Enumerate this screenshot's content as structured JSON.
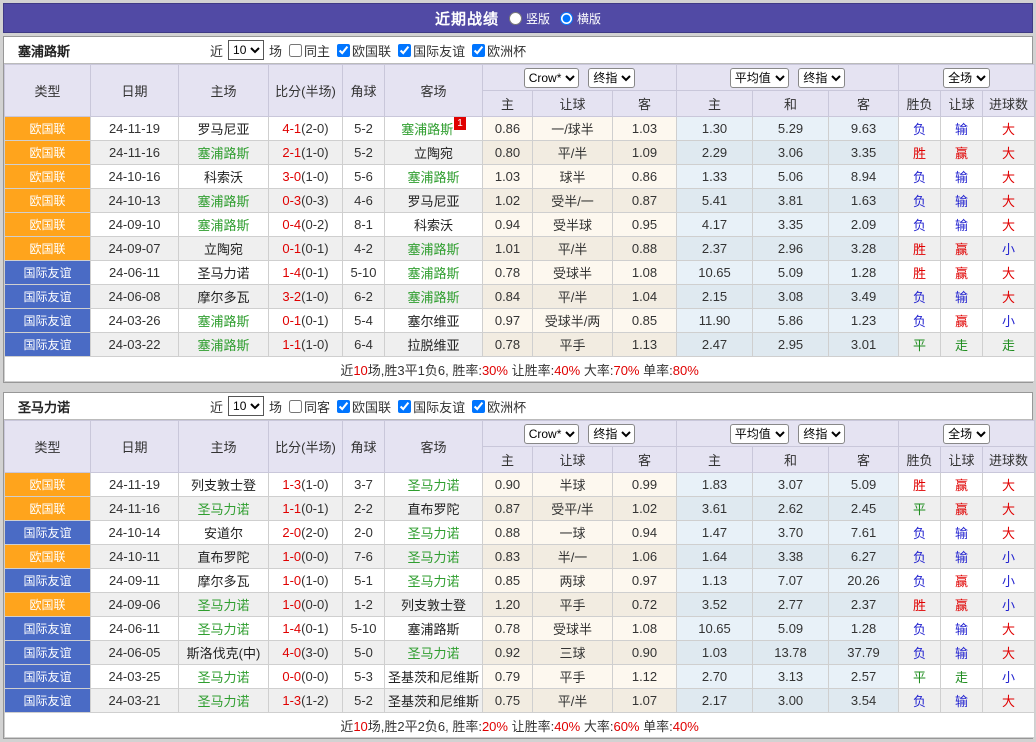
{
  "colors": {
    "header_bar": "#514aa5",
    "league_badge_euro_nations": "#ffa41c",
    "league_badge_friendly": "#4a6bc5",
    "team_highlight_green": "#2f9e2f",
    "win_red": "#e00000",
    "loss_blue": "#2424d0",
    "draw_green": "#1e8c1e",
    "header_row_bg": "#e5e3f2",
    "odds_col_bg": "#fdf8ef",
    "avg_col_bg": "#e8f1f8"
  },
  "title_bar": {
    "title": "近期战绩",
    "vertical_label": "竖版",
    "horizontal_label": "横版"
  },
  "filters": {
    "near_label": "近",
    "count": "10",
    "games_label": "场",
    "leagues": [
      "欧国联",
      "国际友谊",
      "欧洲杯"
    ]
  },
  "columns": {
    "type": "类型",
    "date": "日期",
    "home": "主场",
    "score": "比分(半场)",
    "corner": "角球",
    "away": "客场",
    "sub": [
      "主",
      "让球",
      "客",
      "主",
      "和",
      "客",
      "胜负",
      "让球",
      "进球数"
    ]
  },
  "group_selects": {
    "crow": "Crow*",
    "final": "终指",
    "avg": "平均值",
    "full": "全场"
  },
  "sections": [
    {
      "team": "塞浦路斯",
      "same_label": "同主",
      "rows": [
        {
          "league": "欧国联",
          "date": "24-11-19",
          "home": "罗马尼亚",
          "score": "4-1",
          "half": "(2-0)",
          "corner": "5-2",
          "away": "塞浦路斯",
          "badge": "1",
          "odds": [
            "0.86",
            "一/球半",
            "1.03"
          ],
          "avg": [
            "1.30",
            "5.29",
            "9.63"
          ],
          "results": [
            "负",
            "输",
            "大"
          ]
        },
        {
          "league": "欧国联",
          "date": "24-11-16",
          "home": "塞浦路斯",
          "score": "2-1",
          "half": "(1-0)",
          "corner": "5-2",
          "away": "立陶宛",
          "odds": [
            "0.80",
            "平/半",
            "1.09"
          ],
          "avg": [
            "2.29",
            "3.06",
            "3.35"
          ],
          "results": [
            "胜",
            "赢",
            "大"
          ]
        },
        {
          "league": "欧国联",
          "date": "24-10-16",
          "home": "科索沃",
          "score": "3-0",
          "half": "(1-0)",
          "corner": "5-6",
          "away": "塞浦路斯",
          "odds": [
            "1.03",
            "球半",
            "0.86"
          ],
          "avg": [
            "1.33",
            "5.06",
            "8.94"
          ],
          "results": [
            "负",
            "输",
            "大"
          ]
        },
        {
          "league": "欧国联",
          "date": "24-10-13",
          "home": "塞浦路斯",
          "score": "0-3",
          "half": "(0-3)",
          "corner": "4-6",
          "away": "罗马尼亚",
          "odds": [
            "1.02",
            "受半/一",
            "0.87"
          ],
          "avg": [
            "5.41",
            "3.81",
            "1.63"
          ],
          "results": [
            "负",
            "输",
            "大"
          ]
        },
        {
          "league": "欧国联",
          "date": "24-09-10",
          "home": "塞浦路斯",
          "score": "0-4",
          "half": "(0-2)",
          "corner": "8-1",
          "away": "科索沃",
          "odds": [
            "0.94",
            "受半球",
            "0.95"
          ],
          "avg": [
            "4.17",
            "3.35",
            "2.09"
          ],
          "results": [
            "负",
            "输",
            "大"
          ]
        },
        {
          "league": "欧国联",
          "date": "24-09-07",
          "home": "立陶宛",
          "score": "0-1",
          "half": "(0-1)",
          "corner": "4-2",
          "away": "塞浦路斯",
          "odds": [
            "1.01",
            "平/半",
            "0.88"
          ],
          "avg": [
            "2.37",
            "2.96",
            "3.28"
          ],
          "results": [
            "胜",
            "赢",
            "小"
          ]
        },
        {
          "league": "国际友谊",
          "date": "24-06-11",
          "home": "圣马力诺",
          "score": "1-4",
          "half": "(0-1)",
          "corner": "5-10",
          "away": "塞浦路斯",
          "odds": [
            "0.78",
            "受球半",
            "1.08"
          ],
          "avg": [
            "10.65",
            "5.09",
            "1.28"
          ],
          "results": [
            "胜",
            "赢",
            "大"
          ]
        },
        {
          "league": "国际友谊",
          "date": "24-06-08",
          "home": "摩尔多瓦",
          "score": "3-2",
          "half": "(1-0)",
          "corner": "6-2",
          "away": "塞浦路斯",
          "odds": [
            "0.84",
            "平/半",
            "1.04"
          ],
          "avg": [
            "2.15",
            "3.08",
            "3.49"
          ],
          "results": [
            "负",
            "输",
            "大"
          ]
        },
        {
          "league": "国际友谊",
          "date": "24-03-26",
          "home": "塞浦路斯",
          "score": "0-1",
          "half": "(0-1)",
          "corner": "5-4",
          "away": "塞尔维亚",
          "odds": [
            "0.97",
            "受球半/两",
            "0.85"
          ],
          "avg": [
            "11.90",
            "5.86",
            "1.23"
          ],
          "results": [
            "负",
            "赢",
            "小"
          ]
        },
        {
          "league": "国际友谊",
          "date": "24-03-22",
          "home": "塞浦路斯",
          "score": "1-1",
          "half": "(1-0)",
          "corner": "6-4",
          "away": "拉脱维亚",
          "odds": [
            "0.78",
            "平手",
            "1.13"
          ],
          "avg": [
            "2.47",
            "2.95",
            "3.01"
          ],
          "results": [
            "平",
            "走",
            "走"
          ]
        }
      ],
      "summary": [
        [
          "近",
          "d"
        ],
        [
          "10",
          "r"
        ],
        [
          "场,胜3平1负6, 胜率:",
          "d"
        ],
        [
          "30%",
          "r"
        ],
        [
          " 让胜率:",
          "d"
        ],
        [
          "40%",
          "r"
        ],
        [
          " 大率:",
          "d"
        ],
        [
          "70%",
          "r"
        ],
        [
          " 单率:",
          "d"
        ],
        [
          "80%",
          "r"
        ]
      ]
    },
    {
      "team": "圣马力诺",
      "same_label": "同客",
      "rows": [
        {
          "league": "欧国联",
          "date": "24-11-19",
          "home": "列支敦士登",
          "score": "1-3",
          "half": "(1-0)",
          "corner": "3-7",
          "away": "圣马力诺",
          "odds": [
            "0.90",
            "半球",
            "0.99"
          ],
          "avg": [
            "1.83",
            "3.07",
            "5.09"
          ],
          "results": [
            "胜",
            "赢",
            "大"
          ]
        },
        {
          "league": "欧国联",
          "date": "24-11-16",
          "home": "圣马力诺",
          "score": "1-1",
          "half": "(0-1)",
          "corner": "2-2",
          "away": "直布罗陀",
          "odds": [
            "0.87",
            "受平/半",
            "1.02"
          ],
          "avg": [
            "3.61",
            "2.62",
            "2.45"
          ],
          "results": [
            "平",
            "赢",
            "大"
          ]
        },
        {
          "league": "国际友谊",
          "date": "24-10-14",
          "home": "安道尔",
          "score": "2-0",
          "half": "(2-0)",
          "corner": "2-0",
          "away": "圣马力诺",
          "odds": [
            "0.88",
            "一球",
            "0.94"
          ],
          "avg": [
            "1.47",
            "3.70",
            "7.61"
          ],
          "results": [
            "负",
            "输",
            "大"
          ]
        },
        {
          "league": "欧国联",
          "date": "24-10-11",
          "home": "直布罗陀",
          "score": "1-0",
          "half": "(0-0)",
          "corner": "7-6",
          "away": "圣马力诺",
          "odds": [
            "0.83",
            "半/一",
            "1.06"
          ],
          "avg": [
            "1.64",
            "3.38",
            "6.27"
          ],
          "results": [
            "负",
            "输",
            "小"
          ]
        },
        {
          "league": "国际友谊",
          "date": "24-09-11",
          "home": "摩尔多瓦",
          "score": "1-0",
          "half": "(1-0)",
          "corner": "5-1",
          "away": "圣马力诺",
          "odds": [
            "0.85",
            "两球",
            "0.97"
          ],
          "avg": [
            "1.13",
            "7.07",
            "20.26"
          ],
          "results": [
            "负",
            "赢",
            "小"
          ]
        },
        {
          "league": "欧国联",
          "date": "24-09-06",
          "home": "圣马力诺",
          "score": "1-0",
          "half": "(0-0)",
          "corner": "1-2",
          "away": "列支敦士登",
          "odds": [
            "1.20",
            "平手",
            "0.72"
          ],
          "avg": [
            "3.52",
            "2.77",
            "2.37"
          ],
          "results": [
            "胜",
            "赢",
            "小"
          ]
        },
        {
          "league": "国际友谊",
          "date": "24-06-11",
          "home": "圣马力诺",
          "score": "1-4",
          "half": "(0-1)",
          "corner": "5-10",
          "away": "塞浦路斯",
          "odds": [
            "0.78",
            "受球半",
            "1.08"
          ],
          "avg": [
            "10.65",
            "5.09",
            "1.28"
          ],
          "results": [
            "负",
            "输",
            "大"
          ]
        },
        {
          "league": "国际友谊",
          "date": "24-06-05",
          "home": "斯洛伐克(中)",
          "score": "4-0",
          "half": "(3-0)",
          "corner": "5-0",
          "away": "圣马力诺",
          "odds": [
            "0.92",
            "三球",
            "0.90"
          ],
          "avg": [
            "1.03",
            "13.78",
            "37.79"
          ],
          "results": [
            "负",
            "输",
            "大"
          ]
        },
        {
          "league": "国际友谊",
          "date": "24-03-25",
          "home": "圣马力诺",
          "score": "0-0",
          "half": "(0-0)",
          "corner": "5-3",
          "away": "圣基茨和尼维斯",
          "odds": [
            "0.79",
            "平手",
            "1.12"
          ],
          "avg": [
            "2.70",
            "3.13",
            "2.57"
          ],
          "results": [
            "平",
            "走",
            "小"
          ]
        },
        {
          "league": "国际友谊",
          "date": "24-03-21",
          "home": "圣马力诺",
          "score": "1-3",
          "half": "(1-2)",
          "corner": "5-2",
          "away": "圣基茨和尼维斯",
          "odds": [
            "0.75",
            "平/半",
            "1.07"
          ],
          "avg": [
            "2.17",
            "3.00",
            "3.54"
          ],
          "results": [
            "负",
            "输",
            "大"
          ]
        }
      ],
      "summary": [
        [
          "近",
          "d"
        ],
        [
          "10",
          "r"
        ],
        [
          "场,胜2平2负6, 胜率:",
          "d"
        ],
        [
          "20%",
          "r"
        ],
        [
          " 让胜率:",
          "d"
        ],
        [
          "40%",
          "r"
        ],
        [
          " 大率:",
          "d"
        ],
        [
          "60%",
          "r"
        ],
        [
          " 单率:",
          "d"
        ],
        [
          "40%",
          "r"
        ]
      ]
    }
  ]
}
